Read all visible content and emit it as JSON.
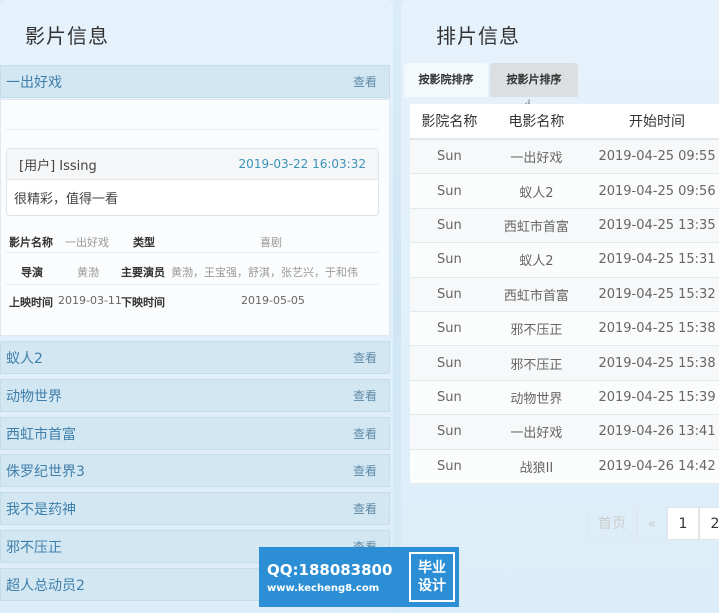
{
  "left": {
    "title": "影片信息",
    "view_label": "查看",
    "first_movie": "一出好戏",
    "comment": {
      "user": "[用户] Issing",
      "time": "2019-03-22 16:03:32",
      "text": "很精彩，值得一看"
    },
    "info": {
      "name_label": "影片名称",
      "name_value": "一出好戏",
      "type_label": "类型",
      "type_value": "喜剧",
      "director_label": "导演",
      "director_value": "黄渤",
      "actors_label": "主要演员",
      "actors_value": "黄渤，王宝强，舒淇，张艺兴，于和伟",
      "release_label": "上映时间",
      "release_value": "2019-03-11",
      "end_label": "下映时间",
      "end_value": "2019-05-05"
    },
    "movies": [
      "蚁人2",
      "动物世界",
      "西虹市首富",
      "侏罗纪世界3",
      "我不是药神",
      "邪不压正",
      "超人总动员2"
    ]
  },
  "right": {
    "title": "排片信息",
    "tabs": [
      "按影院排序",
      "按影片排序"
    ],
    "columns": [
      "影院名称",
      "电影名称",
      "开始时间"
    ],
    "rows": [
      [
        "Sun",
        "一出好戏",
        "2019-04-25 09:55"
      ],
      [
        "Sun",
        "蚁人2",
        "2019-04-25 09:56"
      ],
      [
        "Sun",
        "西虹市首富",
        "2019-04-25 13:35"
      ],
      [
        "Sun",
        "蚁人2",
        "2019-04-25 15:31"
      ],
      [
        "Sun",
        "西虹市首富",
        "2019-04-25 15:32"
      ],
      [
        "Sun",
        "邪不压正",
        "2019-04-25 15:38"
      ],
      [
        "Sun",
        "邪不压正",
        "2019-04-25 15:38"
      ],
      [
        "Sun",
        "动物世界",
        "2019-04-25 15:39"
      ],
      [
        "Sun",
        "一出好戏",
        "2019-04-26 13:41"
      ],
      [
        "Sun",
        "战狼II",
        "2019-04-26 14:42"
      ]
    ],
    "pager": {
      "first": "首页",
      "prev": "«",
      "p1": "1",
      "p2": "2"
    }
  },
  "watermark": {
    "qq": "QQ:188083800",
    "url": "www.kecheng8.com",
    "badge_line1": "毕业",
    "badge_line2": "设计"
  }
}
